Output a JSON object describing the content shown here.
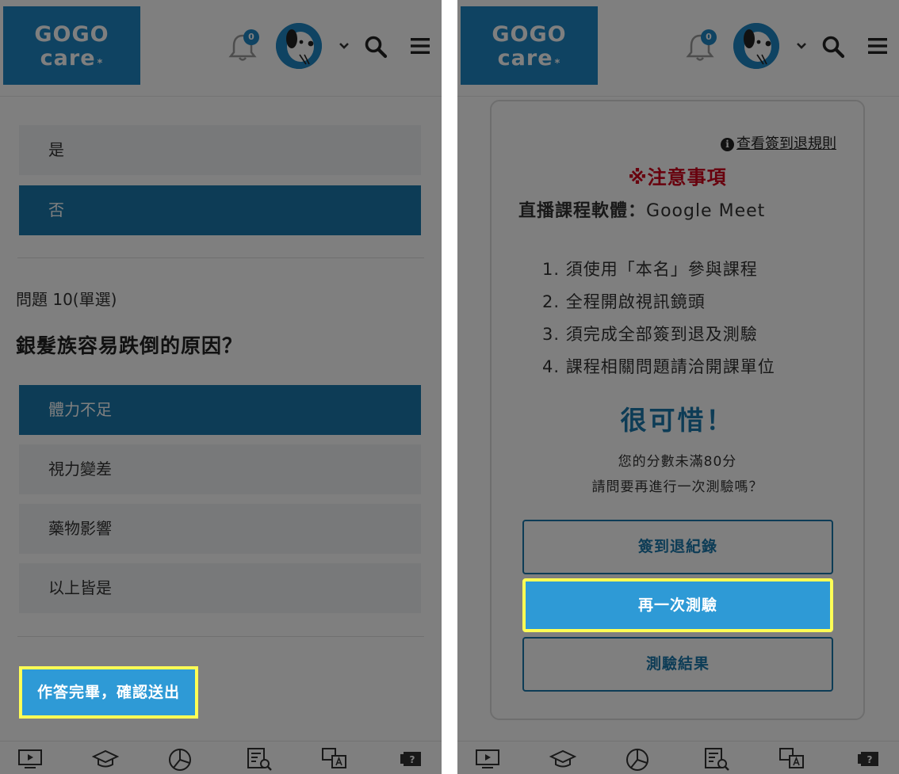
{
  "header": {
    "logo_line1": "GOGO",
    "logo_line2": "care",
    "logo_mark": "*",
    "notification_count": "0",
    "icons": [
      "bell-icon",
      "avatar",
      "chevron-down-icon",
      "search-icon",
      "menu-icon"
    ]
  },
  "left": {
    "prev_options": [
      {
        "label": "是",
        "selected": false
      },
      {
        "label": "否",
        "selected": true
      }
    ],
    "question_number": "問題 10(單選)",
    "question_text": "銀髮族容易跌倒的原因？",
    "options": [
      {
        "label": "體力不足",
        "selected": true
      },
      {
        "label": "視力變差",
        "selected": false
      },
      {
        "label": "藥物影響",
        "selected": false
      },
      {
        "label": "以上皆是",
        "selected": false
      }
    ],
    "submit_label": "作答完畢，確認送出"
  },
  "right": {
    "rules_link": "查看簽到退規則",
    "notice_title": "※注意事項",
    "software_label": "直播課程軟體：",
    "software_value": "Google Meet",
    "rules": [
      "1. 須使用「本名」參與課程",
      "2. 全程開啟視訊鏡頭",
      "3. 須完成全部簽到退及測驗",
      "4. 課程相關問題請洽開課單位"
    ],
    "result_title": "很可惜！",
    "result_line1": "您的分數未滿80分",
    "result_line2": "請問要再進行一次測驗嗎？",
    "buttons": {
      "checkin_records": "簽到退紀錄",
      "retake_quiz": "再一次測驗",
      "quiz_results": "測驗結果"
    }
  },
  "bottom_nav": [
    "course-video-icon",
    "graduation-cap-icon",
    "pie-chart-icon",
    "record-search-icon",
    "translate-icon",
    "help-ticket-icon"
  ],
  "colors": {
    "brand_blue": "#1f87c4",
    "selected_option": "#1a78ac",
    "button_blue": "#2e9ad6",
    "highlight_yellow": "#ffff55",
    "notice_red": "#d0021b"
  }
}
